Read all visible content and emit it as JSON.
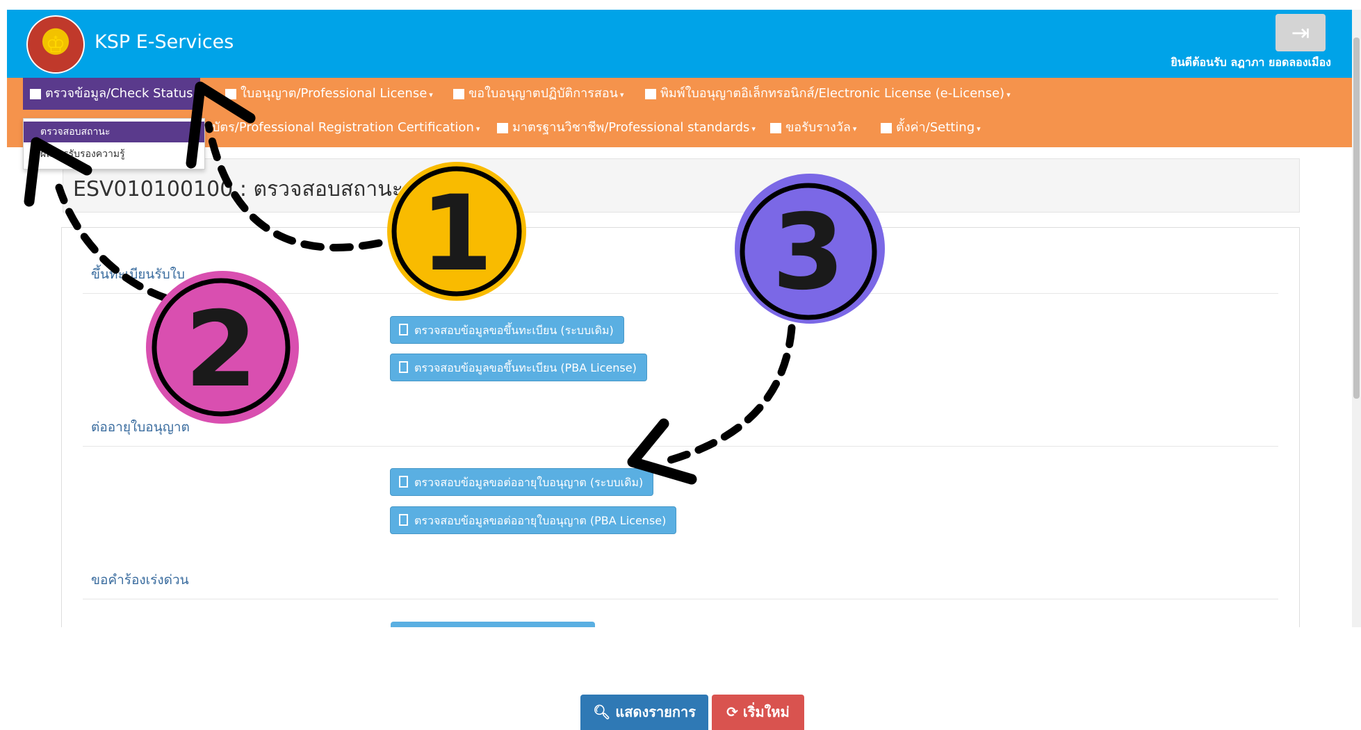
{
  "header": {
    "brand": "KSP E-Services",
    "welcome": "ยินดีต้อนรับ ลฎาภา ยอดลองเมือง",
    "logout_icon": "sign-out-icon"
  },
  "menu": {
    "row1": [
      {
        "label": "ตรวจข้อมูล/Check Status",
        "caret": ""
      },
      {
        "label": "ใบอนุญาต/Professional License",
        "caret": "▾"
      },
      {
        "label": "ขอใบอนุญาตปฏิบัติการสอน",
        "caret": "▾"
      },
      {
        "label": "พิมพ์ใบอนุญาตอิเล็กทรอนิกส์/Electronic License (e-License)",
        "caret": "▾"
      }
    ],
    "row2": [
      {
        "label": "บัตร/Professional Registration Certification",
        "caret": "▾"
      },
      {
        "label": "มาตรฐานวิชาชีพ/Professional standards",
        "caret": "▾"
      },
      {
        "label": "ขอรับรางวัล",
        "caret": "▾"
      },
      {
        "label": "ตั้งค่า/Setting",
        "caret": "▾"
      }
    ]
  },
  "dropdown": {
    "items": [
      "ตรวจสอบสถานะ",
      "ผลการรับรองความรู้"
    ]
  },
  "page": {
    "title": "ESV010100100 : ตรวจสอบสถานะ"
  },
  "sections": [
    {
      "title": "ขึ้นทะเบียนรับใบ",
      "buttons": [
        "ตรวจสอบข้อมูลขอขึ้นทะเบียน (ระบบเดิม)",
        "ตรวจสอบข้อมูลขอขึ้นทะเบียน (PBA License)"
      ]
    },
    {
      "title": "ต่ออายุใบอนุญาต",
      "buttons": [
        "ตรวจสอบข้อมูลขอต่ออายุใบอนุญาต (ระบบเดิม)",
        "ตรวจสอบข้อมูลขอต่ออายุใบอนุญาต (PBA License)"
      ]
    },
    {
      "title": "ขอคำร้องเร่งด่วน",
      "buttons": []
    }
  ],
  "footer": {
    "show_label": "แสดงรายการ",
    "reset_label": "เริ่มใหม่"
  },
  "annotations": {
    "numbers": [
      "1",
      "2",
      "3"
    ],
    "colors": {
      "one": "#f9bb00",
      "two": "#d94fb0",
      "three": "#7b68e6"
    }
  }
}
